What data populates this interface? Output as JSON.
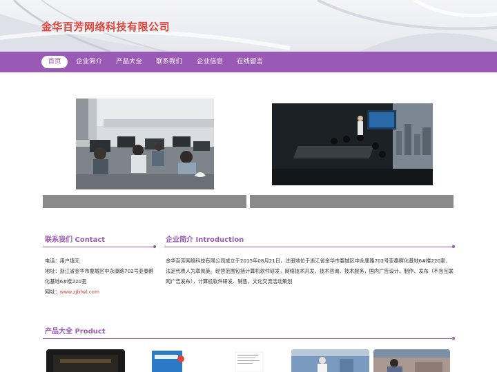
{
  "header": {
    "site_title": "金华百芳网络科技有限公司"
  },
  "nav": {
    "items": [
      {
        "label": "首页",
        "active": true
      },
      {
        "label": "企业简介",
        "active": false
      },
      {
        "label": "产品大全",
        "active": false
      },
      {
        "label": "联系我们",
        "active": false
      },
      {
        "label": "企业信息",
        "active": false
      },
      {
        "label": "在线留言",
        "active": false
      }
    ]
  },
  "contact": {
    "title": "联系我们 Contact",
    "line_contact": "电话：用户填无",
    "line_address_1": "地址：浙江省金华市婺城区中永康路702号亚泰孵",
    "line_address_2": "化基地6#楼220室",
    "website_prefix": "网址：",
    "website": "www.zjbfwl.com"
  },
  "intro": {
    "title": "企业简介 Introduction",
    "text": "金华百芳网络科技有限公司成立于2015年08月21日，注册地位于浙江省金华市婺城区中永康路702号亚泰孵化基地6#楼220室，法定代表人为章岚英。经营范围包括计算机软件研发，网络技术开发、技术咨询、技术服务，国内广告设计、制作、发布（不含互联网广告发布），计算机软件研发、销售，文化交流活动策划"
  },
  "products": {
    "title": "产品大全 Product"
  },
  "colors": {
    "accent": "#9b59b6",
    "title_red": "#e0453a",
    "caption_gray": "#8a8a8a"
  }
}
